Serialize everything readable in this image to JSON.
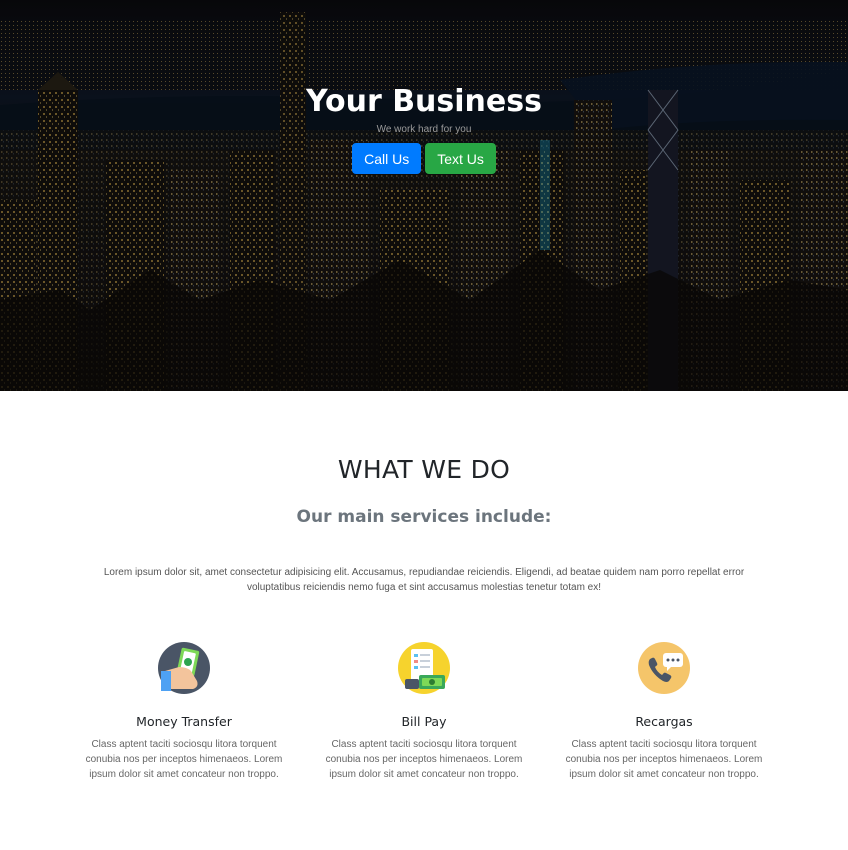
{
  "hero": {
    "title": "Your Business",
    "subtitle": "We work hard for you",
    "buttons": {
      "call_label": "Call Us",
      "text_label": "Text Us"
    },
    "background": "night-city-skyline-photo"
  },
  "services": {
    "heading": "WHAT WE DO",
    "subheading": "Our main services include:",
    "description": "Lorem ipsum dolor sit, amet consectetur adipisicing elit. Accusamus, repudiandae reiciendis. Eligendi, ad beatae quidem nam porro repellat error voluptatibus reiciendis nemo fuga et sint accusamus molestias tenetur totam ex!",
    "items": [
      {
        "title": "Money Transfer",
        "icon": "money-transfer-icon",
        "text": "Class aptent taciti sociosqu litora torquent conubia nos per inceptos himenaeos. Lorem ipsum dolor sit amet concateur non troppo."
      },
      {
        "title": "Bill Pay",
        "icon": "bill-pay-icon",
        "text": "Class aptent taciti sociosqu litora torquent conubia nos per inceptos himenaeos. Lorem ipsum dolor sit amet concateur non troppo."
      },
      {
        "title": "Recargas",
        "icon": "phone-recharge-icon",
        "text": "Class aptent taciti sociosqu litora torquent conubia nos per inceptos himenaeos. Lorem ipsum dolor sit amet concateur non troppo."
      }
    ]
  },
  "colors": {
    "primary": "#007bff",
    "success": "#28a745",
    "heading": "#212529",
    "muted": "#6c757d"
  }
}
